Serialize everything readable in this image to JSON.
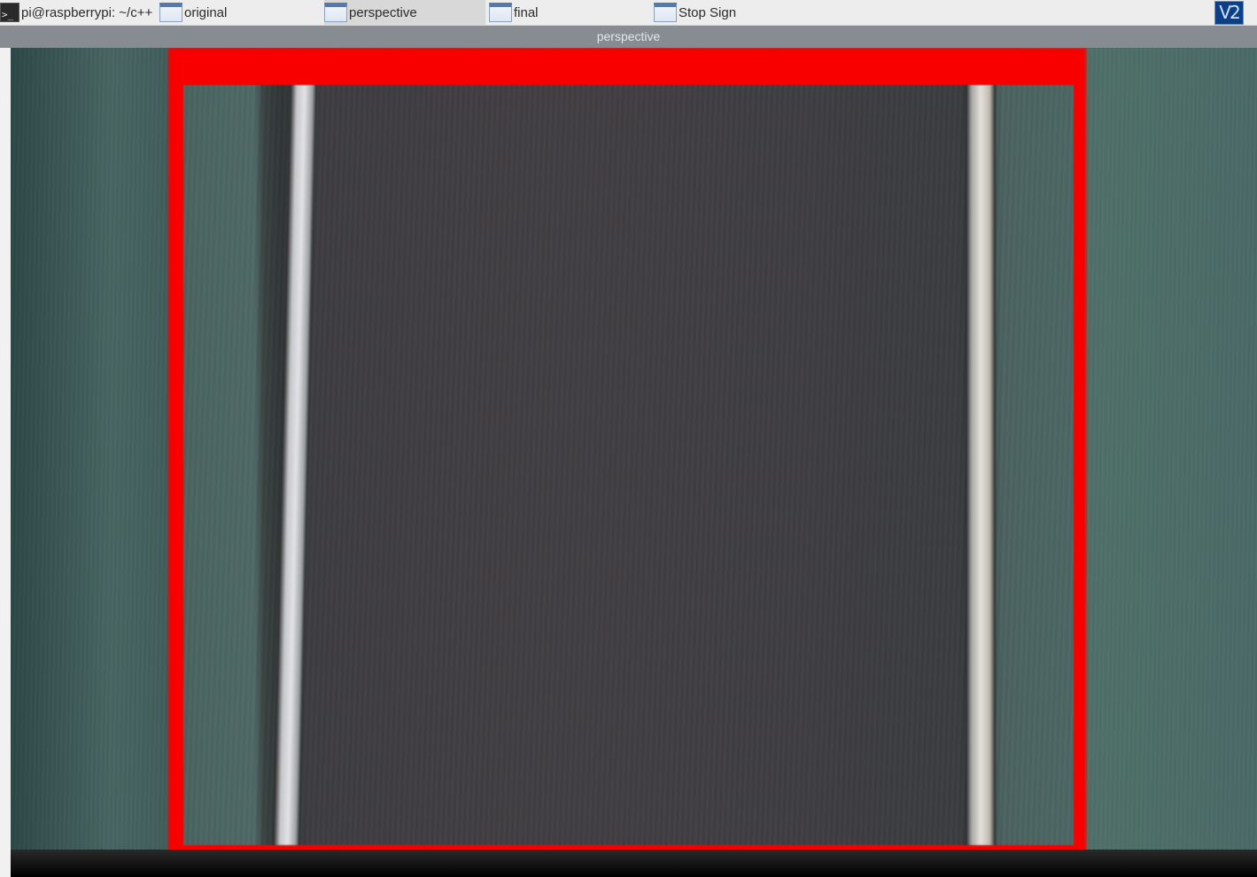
{
  "taskbar": {
    "items": [
      {
        "label": "pi@raspberrypi: ~/c++",
        "icon": "terminal-icon",
        "active": false
      },
      {
        "label": "original",
        "icon": "window-icon",
        "active": false
      },
      {
        "label": "perspective",
        "icon": "window-icon",
        "active": true
      },
      {
        "label": "final",
        "icon": "window-icon",
        "active": false
      },
      {
        "label": "Stop Sign",
        "icon": "window-icon",
        "active": false
      }
    ],
    "tray_icon": "vnc-icon",
    "tray_text": "V2"
  },
  "window": {
    "title": "perspective"
  },
  "colors": {
    "frame": "#f80000",
    "taskbar_bg": "#ededed",
    "titlebar_bg": "#878c92"
  }
}
